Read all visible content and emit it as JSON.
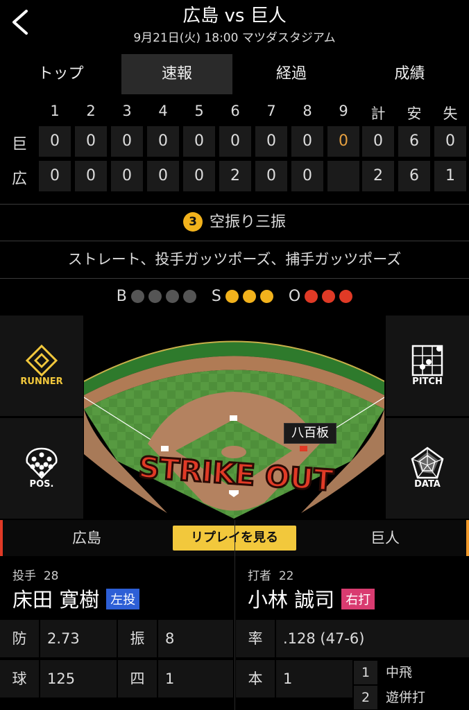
{
  "header": {
    "title": "広島 vs 巨人",
    "subtitle": "9月21日(火) 18:00 マツダスタジアム"
  },
  "tabs": [
    {
      "label": "トップ",
      "active": false
    },
    {
      "label": "速報",
      "active": true
    },
    {
      "label": "経過",
      "active": false
    },
    {
      "label": "成績",
      "active": false
    }
  ],
  "scoreboard": {
    "columns": [
      "1",
      "2",
      "3",
      "4",
      "5",
      "6",
      "7",
      "8",
      "9",
      "計",
      "安",
      "失"
    ],
    "teams": [
      {
        "label": "巨",
        "cells": [
          "0",
          "0",
          "0",
          "0",
          "0",
          "0",
          "0",
          "0",
          "0",
          "0",
          "6",
          "0"
        ]
      },
      {
        "label": "広",
        "cells": [
          "0",
          "0",
          "0",
          "0",
          "0",
          "2",
          "0",
          "0",
          "",
          "2",
          "6",
          "1"
        ]
      }
    ]
  },
  "play": {
    "outs_badge": "3",
    "result": "空振り三振",
    "description": "ストレート、投手ガッツポーズ、捕手ガッツポーズ"
  },
  "count": {
    "b_label": "B",
    "balls": 0,
    "balls_max": 4,
    "s_label": "S",
    "strikes": 3,
    "strikes_max": 3,
    "o_label": "O",
    "outs": 3,
    "outs_max": 3
  },
  "field": {
    "runner_label": "RUNNER",
    "pos_label": "POS.",
    "pitch_label": "PITCH",
    "data_label": "DATA",
    "batter_tag": "八百板",
    "overlay": "STRIKE OUT"
  },
  "replay": {
    "team_left": "広島",
    "button": "リプレイを見る",
    "team_right": "巨人"
  },
  "pitcher": {
    "role": "投手",
    "number": "28",
    "name": "床田 寛樹",
    "hand": "左投"
  },
  "batter": {
    "role": "打者",
    "number": "22",
    "name": "小林 誠司",
    "hand": "右打"
  },
  "pitcher_stats": [
    {
      "label": "防",
      "value": "2.73",
      "label2": "振",
      "value2": "8"
    },
    {
      "label": "球",
      "value": "125",
      "label2": "四",
      "value2": "1"
    }
  ],
  "batter_stats": [
    {
      "label": "率",
      "value": ".128 (47-6)"
    },
    {
      "label": "本",
      "value": "1"
    }
  ],
  "at_bats": [
    {
      "n": "1",
      "result": "中飛"
    },
    {
      "n": "2",
      "result": "遊併打"
    }
  ],
  "colors": {
    "strike": "#f2b21c",
    "out": "#e03a26",
    "ball": "#555555",
    "runner_accent": "#f2c83c",
    "left_hand": "#2d5fd6",
    "right_hand": "#d93b70"
  }
}
